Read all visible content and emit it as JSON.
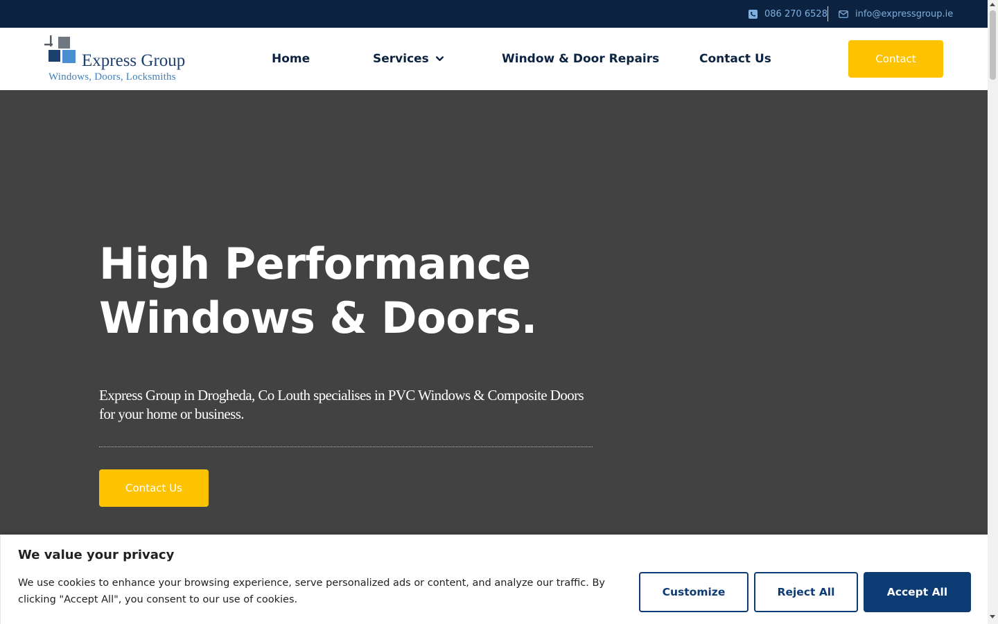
{
  "topbar": {
    "phone": "086 270 6528",
    "email": "info@expressgroup.ie",
    "phone_icon": "phone-square-icon",
    "email_icon": "envelope-icon"
  },
  "logo": {
    "name": "Express Group",
    "tagline": "Windows, Doors, Locksmiths"
  },
  "nav": {
    "items": [
      {
        "label": "Home"
      },
      {
        "label": "Services",
        "has_dropdown": true
      },
      {
        "label": "Window & Door Repairs"
      },
      {
        "label": "Contact Us"
      }
    ],
    "cta_label": "Contact"
  },
  "hero": {
    "title_line1": "High Performance",
    "title_line2": "Windows & Doors.",
    "lead": "Express Group in Drogheda, Co Louth specialises in PVC Windows & Composite Doors for your home or business.",
    "cta_label": "Contact Us"
  },
  "cookie": {
    "title": "We value your privacy",
    "body": "We use cookies to enhance your browsing experience, serve personalized ads or content, and analyze our traffic. By clicking \"Accept All\", you consent to our use of cookies.",
    "customize_label": "Customize",
    "reject_label": "Reject All",
    "accept_label": "Accept All"
  },
  "colors": {
    "topbar_bg": "#0b2340",
    "accent_yellow": "#fdc300",
    "hero_bg": "#424242",
    "brand_navy": "#0d3b73",
    "topbar_text": "#7fb0e0"
  }
}
